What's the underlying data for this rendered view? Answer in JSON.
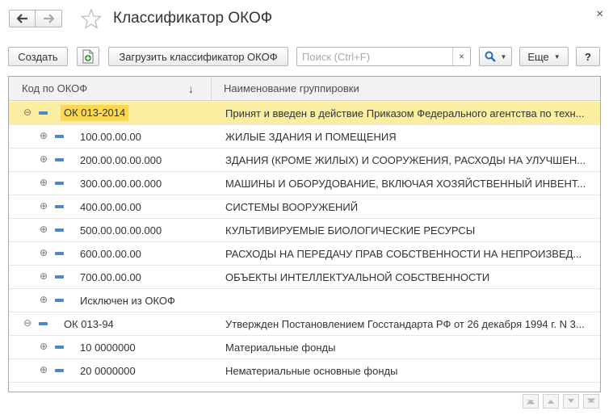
{
  "window": {
    "title": "Классификатор ОКОФ",
    "close_glyph": "×"
  },
  "toolbar": {
    "create_label": "Создать",
    "load_label": "Загрузить классификатор ОКОФ",
    "search_placeholder": "Поиск (Ctrl+F)",
    "search_value": "",
    "clear_glyph": "×",
    "more_label": "Еще",
    "help_label": "?"
  },
  "table": {
    "columns": [
      "Код по ОКОФ",
      "Наименование группировки"
    ],
    "sort_glyph": "↓",
    "rows": [
      {
        "code": "ОК 013-2014",
        "name": "Принят и введен в действие Приказом Федерального агентства по техн...",
        "level": 0,
        "expander": "⊖",
        "selected": true
      },
      {
        "code": "100.00.00.00",
        "name": "ЖИЛЫЕ ЗДАНИЯ И ПОМЕЩЕНИЯ",
        "level": 1,
        "expander": "⊕",
        "selected": false
      },
      {
        "code": "200.00.00.00.000",
        "name": "ЗДАНИЯ (КРОМЕ ЖИЛЫХ) И СООРУЖЕНИЯ, РАСХОДЫ НА УЛУЧШЕН...",
        "level": 1,
        "expander": "⊕",
        "selected": false
      },
      {
        "code": "300.00.00.00.000",
        "name": "МАШИНЫ И ОБОРУДОВАНИЕ, ВКЛЮЧАЯ ХОЗЯЙСТВЕННЫЙ ИНВЕНТ...",
        "level": 1,
        "expander": "⊕",
        "selected": false
      },
      {
        "code": "400.00.00.00",
        "name": "СИСТЕМЫ ВООРУЖЕНИЙ",
        "level": 1,
        "expander": "⊕",
        "selected": false
      },
      {
        "code": "500.00.00.00.000",
        "name": "КУЛЬТИВИРУЕМЫЕ БИОЛОГИЧЕСКИЕ РЕСУРСЫ",
        "level": 1,
        "expander": "⊕",
        "selected": false
      },
      {
        "code": "600.00.00.00",
        "name": "РАСХОДЫ НА ПЕРЕДАЧУ ПРАВ СОБСТВЕННОСТИ НА НЕПРОИЗВЕД...",
        "level": 1,
        "expander": "⊕",
        "selected": false
      },
      {
        "code": "700.00.00.00",
        "name": "ОБЪЕКТЫ ИНТЕЛЛЕКТУАЛЬНОЙ СОБСТВЕННОСТИ",
        "level": 1,
        "expander": "⊕",
        "selected": false
      },
      {
        "code": "Исключен из ОКОФ",
        "name": "",
        "level": 1,
        "expander": "⊕",
        "selected": false
      },
      {
        "code": "ОК 013-94",
        "name": "Утвержден Постановлением Госстандарта РФ от 26 декабря 1994 г. N 3...",
        "level": 0,
        "expander": "⊖",
        "selected": false
      },
      {
        "code": "10 0000000",
        "name": "Материальные фонды",
        "level": 1,
        "expander": "⊕",
        "selected": false
      },
      {
        "code": "20 0000000",
        "name": "Нематериальные основные фонды",
        "level": 1,
        "expander": "⊕",
        "selected": false
      }
    ]
  },
  "colors": {
    "selected_row": "#fbeea0",
    "highlight": "#fbd84f",
    "item_marker": "#4f86c6",
    "accent_green": "#3a9b3a"
  },
  "icons": {
    "back": "arrow-left-icon",
    "forward": "arrow-right-icon",
    "favorite": "star-icon",
    "close": "close-icon",
    "load": "load-file-icon",
    "search": "magnifier-icon",
    "scroll_first": "double-up-icon",
    "scroll_up": "up-icon",
    "scroll_down": "down-icon",
    "scroll_last": "double-down-icon"
  }
}
